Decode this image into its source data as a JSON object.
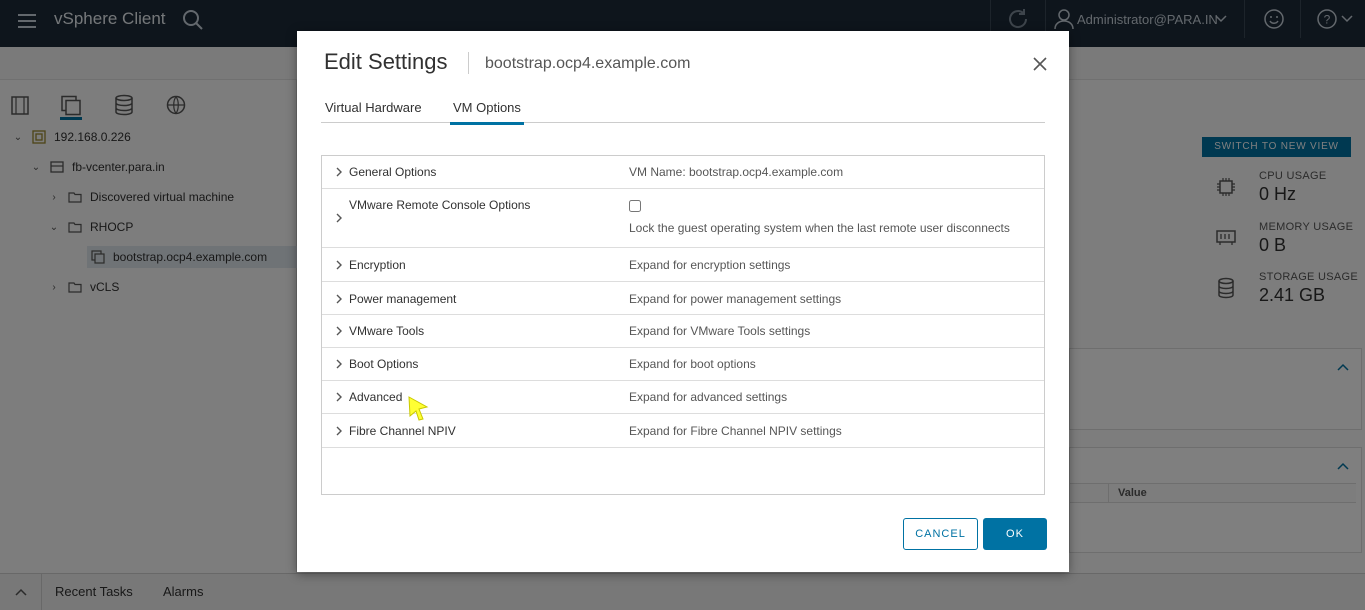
{
  "topbar": {
    "app_title": "vSphere Client",
    "user_name": "Administrator@PARA.IN"
  },
  "tree": {
    "items": [
      {
        "label": "192.168.0.226",
        "twisty": "down"
      },
      {
        "label": "fb-vcenter.para.in",
        "twisty": "down"
      },
      {
        "label": "Discovered virtual machine",
        "twisty": "right"
      },
      {
        "label": "RHOCP",
        "twisty": "down"
      },
      {
        "label": "bootstrap.ocp4.example.com",
        "twisty": "",
        "selected": true
      },
      {
        "label": "vCLS",
        "twisty": "right"
      }
    ]
  },
  "summary": {
    "switch_view": "SWITCH TO NEW VIEW",
    "cpu_label": "CPU USAGE",
    "cpu_value": "0 Hz",
    "memory_label": "MEMORY USAGE",
    "memory_value": "0 B",
    "storage_label": "STORAGE USAGE",
    "storage_value": "2.41 GB",
    "value_header": "Value"
  },
  "bottom": {
    "tab_recent": "Recent Tasks",
    "tab_alarms": "Alarms"
  },
  "modal": {
    "title": "Edit Settings",
    "subtitle": "bootstrap.ocp4.example.com",
    "tabs": [
      "Virtual Hardware",
      "VM Options"
    ],
    "active_tab": "VM Options",
    "rows": [
      {
        "name": "General Options",
        "value": "VM Name: bootstrap.ocp4.example.com"
      },
      {
        "name": "VMware Remote Console Options",
        "value": "Lock the guest operating system when the last remote user disconnects",
        "checked": false
      },
      {
        "name": "Encryption",
        "value": "Expand for encryption settings"
      },
      {
        "name": "Power management",
        "value": "Expand for power management settings"
      },
      {
        "name": "VMware Tools",
        "value": "Expand for VMware Tools settings"
      },
      {
        "name": "Boot Options",
        "value": "Expand for boot options"
      },
      {
        "name": "Advanced",
        "value": "Expand for advanced settings"
      },
      {
        "name": "Fibre Channel NPIV",
        "value": "Expand for Fibre Channel NPIV settings"
      }
    ],
    "cancel_label": "CANCEL",
    "ok_label": "OK"
  },
  "colors": {
    "accent": "#0072a3",
    "topbar": "#1d2a38",
    "cursor": "#ffff33"
  }
}
